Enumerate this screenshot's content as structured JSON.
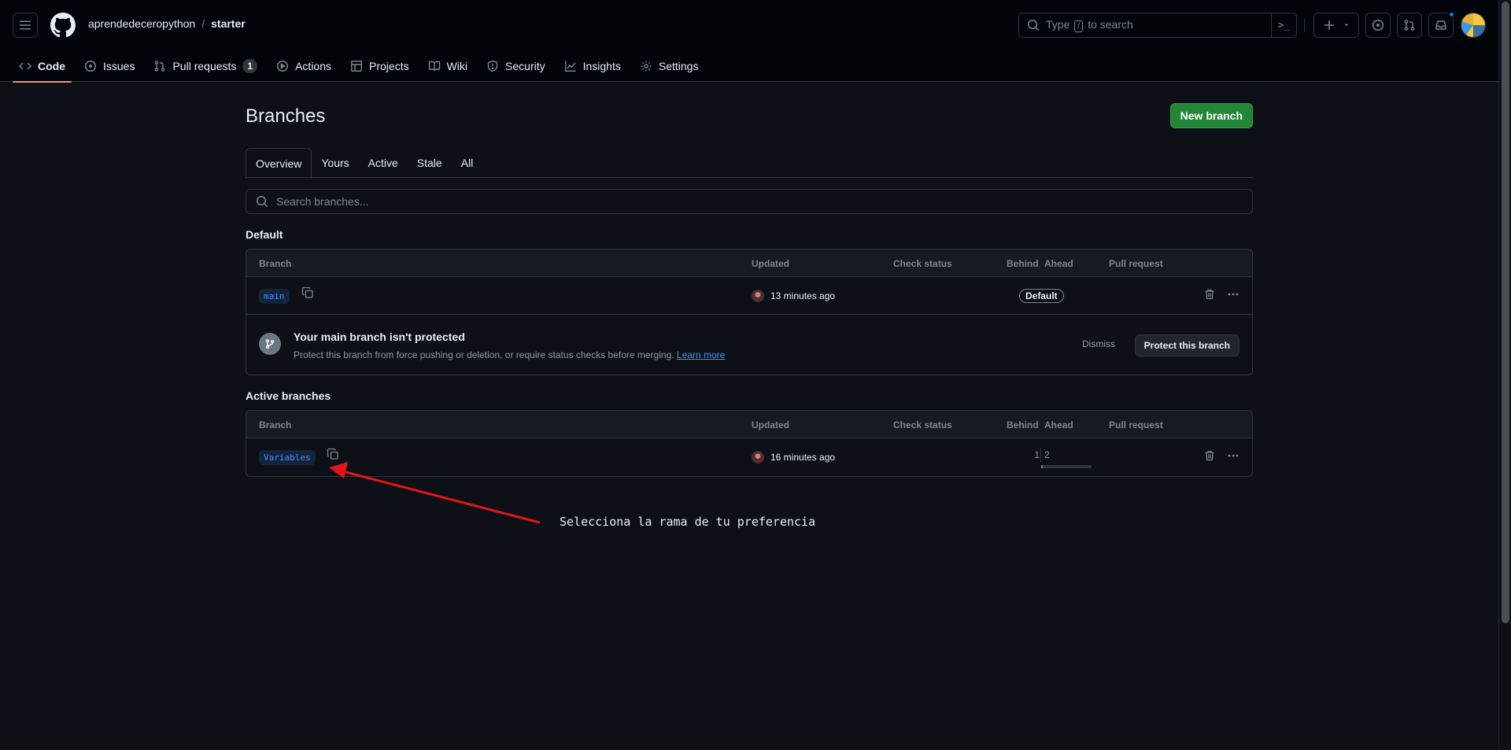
{
  "header": {
    "owner": "aprendedeceropython",
    "separator": "/",
    "repo": "starter",
    "search_prefix": "Type",
    "search_key": "/",
    "search_suffix": "to search",
    "cmd_glyph": ">_"
  },
  "repo_tabs": [
    {
      "label": "Code",
      "icon": "code-icon"
    },
    {
      "label": "Issues",
      "icon": "issue-icon"
    },
    {
      "label": "Pull requests",
      "icon": "pull-request-icon",
      "count": "1"
    },
    {
      "label": "Actions",
      "icon": "play-icon"
    },
    {
      "label": "Projects",
      "icon": "table-icon"
    },
    {
      "label": "Wiki",
      "icon": "book-icon"
    },
    {
      "label": "Security",
      "icon": "shield-icon"
    },
    {
      "label": "Insights",
      "icon": "graph-icon"
    },
    {
      "label": "Settings",
      "icon": "gear-icon"
    }
  ],
  "page": {
    "title": "Branches",
    "new_branch": "New branch",
    "subtabs": [
      "Overview",
      "Yours",
      "Active",
      "Stale",
      "All"
    ],
    "search_placeholder": "Search branches..."
  },
  "columns": {
    "branch": "Branch",
    "updated": "Updated",
    "check": "Check status",
    "behind": "Behind",
    "ahead": "Ahead",
    "pr": "Pull request"
  },
  "default_section": {
    "heading": "Default",
    "branch": "main",
    "updated": "13 minutes ago",
    "badge": "Default"
  },
  "protect_banner": {
    "title": "Your main branch isn't protected",
    "desc": "Protect this branch from force pushing or deletion, or require status checks before merging.",
    "link": "Learn more",
    "dismiss": "Dismiss",
    "button": "Protect this branch"
  },
  "active_section": {
    "heading": "Active branches",
    "branch": "Variables",
    "updated": "16 minutes ago",
    "behind": "1",
    "ahead": "2"
  },
  "annotation": {
    "text": "Selecciona la rama de tu preferencia",
    "color": "#e8141c"
  }
}
